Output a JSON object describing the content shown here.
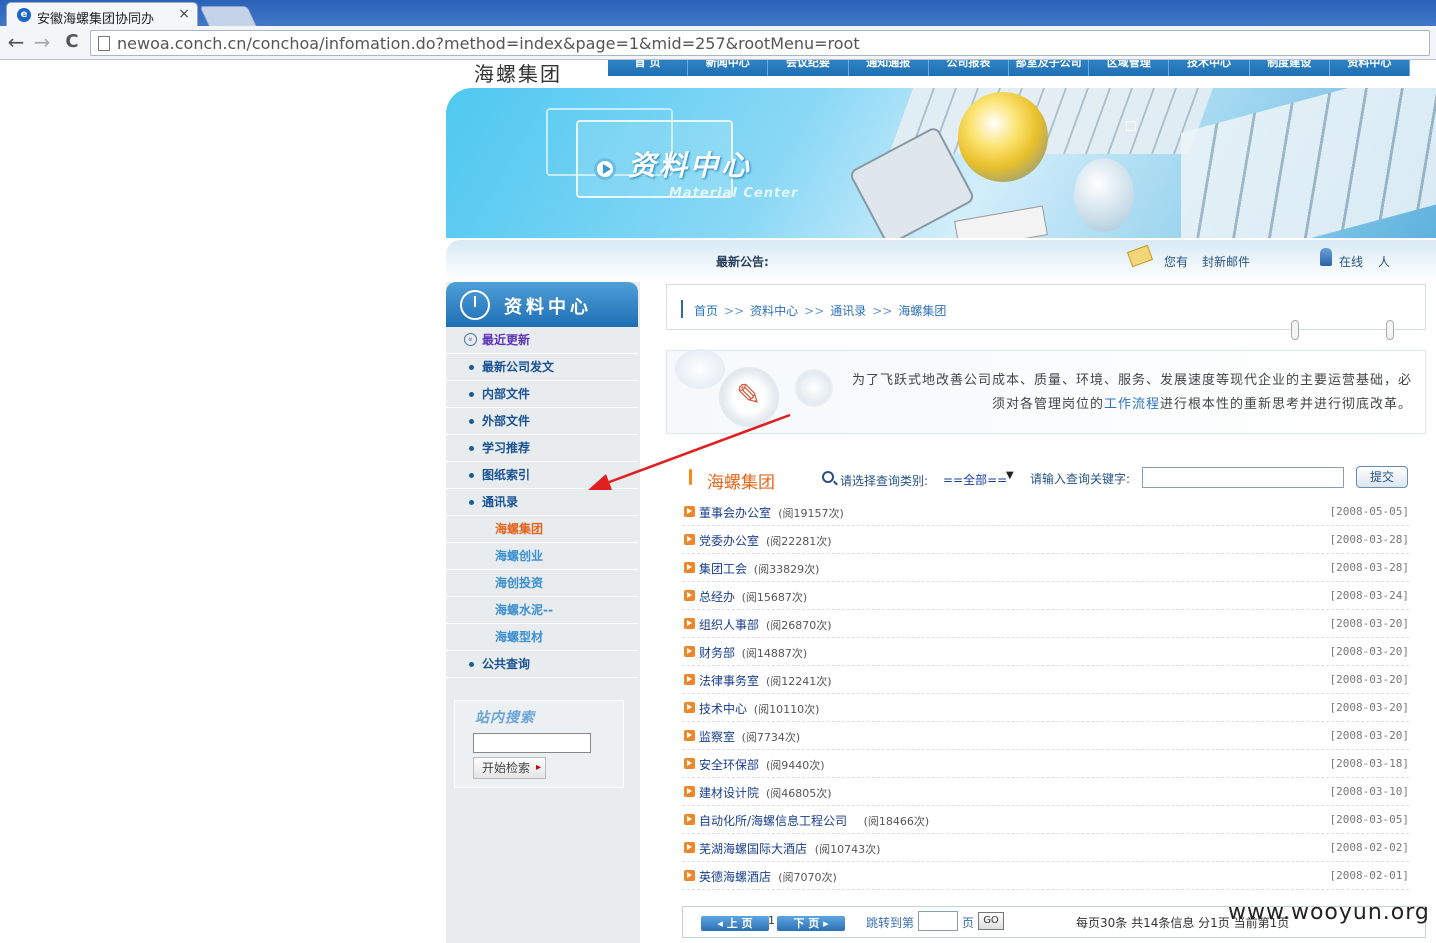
{
  "browser": {
    "tab_title": "安徽海螺集团协同办",
    "tab_close": "×",
    "url": "newoa.conch.cn/conchoa/infomation.do?method=index&page=1&mid=257&rootMenu=root",
    "back": "←",
    "forward": "→",
    "reload": "C"
  },
  "site": {
    "logo": "海螺集团",
    "menu": [
      "首 页",
      "新闻中心",
      "会议纪要",
      "通知通报",
      "公司报表",
      "部室及子公司",
      "区域管理",
      "技术中心",
      "制度建设",
      "资料中心"
    ],
    "banner_title": "资料中心",
    "banner_sub": "Material Center",
    "notice_label": "最新公告:",
    "mail_text1": "您有",
    "mail_text2": "封新邮件",
    "online_text1": "在线",
    "online_text2": "人"
  },
  "sidebar": {
    "title": "资料中心",
    "items": [
      {
        "label": "最近更新",
        "kind": "current"
      },
      {
        "label": "最新公司发文",
        "kind": "item"
      },
      {
        "label": "内部文件",
        "kind": "item"
      },
      {
        "label": "外部文件",
        "kind": "item"
      },
      {
        "label": "学习推荐",
        "kind": "item"
      },
      {
        "label": "图纸索引",
        "kind": "item"
      },
      {
        "label": "通讯录",
        "kind": "item"
      },
      {
        "label": "海螺集团",
        "kind": "sub-active"
      },
      {
        "label": "海螺创业",
        "kind": "sub"
      },
      {
        "label": "海创投资",
        "kind": "sub"
      },
      {
        "label": "海螺水泥--",
        "kind": "sub"
      },
      {
        "label": "海螺型材",
        "kind": "sub"
      },
      {
        "label": "公共查询",
        "kind": "item"
      }
    ],
    "search_title": "站内搜索",
    "search_button": "开始检索"
  },
  "breadcrumb": [
    "首页",
    "资料中心",
    "通讯录",
    "海螺集团"
  ],
  "breadcrumb_sep": ">>",
  "slogan": {
    "part1": "为了飞跃式地改善公司成本、质量、环境、服务、发展速度等现代企业的主要运营基础，必须对各管理岗位的",
    "highlight": "工作流程",
    "part2": "进行根本性的重新思考并进行彻底改革。"
  },
  "list": {
    "title": "海螺集团",
    "category_label": "请选择查询类别:",
    "category_value": "==全部==",
    "keyword_label": "请输入查询关键字:",
    "submit": "提交",
    "rows": [
      {
        "name": "董事会办公室",
        "views": "(阅19157次)",
        "date": "[2008-05-05]"
      },
      {
        "name": "党委办公室",
        "views": "(阅22281次)",
        "date": "[2008-03-28]"
      },
      {
        "name": "集团工会",
        "views": "(阅33829次)",
        "date": "[2008-03-28]"
      },
      {
        "name": "总经办",
        "views": "(阅15687次)",
        "date": "[2008-03-24]"
      },
      {
        "name": "组织人事部",
        "views": "(阅26870次)",
        "date": "[2008-03-20]"
      },
      {
        "name": "财务部",
        "views": "(阅14887次)",
        "date": "[2008-03-20]"
      },
      {
        "name": "法律事务室",
        "views": "(阅12241次)",
        "date": "[2008-03-20]"
      },
      {
        "name": "技术中心",
        "views": "(阅10110次)",
        "date": "[2008-03-20]"
      },
      {
        "name": "监察室",
        "views": "(阅7734次)",
        "date": "[2008-03-20]"
      },
      {
        "name": "安全环保部",
        "views": "(阅9440次)",
        "date": "[2008-03-18]"
      },
      {
        "name": "建材设计院",
        "views": "(阅46805次)",
        "date": "[2008-03-10]"
      },
      {
        "name": "自动化所/海螺信息工程公司",
        "views": "(阅18466次)",
        "date": "[2008-03-05]"
      },
      {
        "name": "芜湖海螺国际大酒店",
        "views": "(阅10743次)",
        "date": "[2008-02-02]"
      },
      {
        "name": "英德海螺酒店",
        "views": "(阅7070次)",
        "date": "[2008-02-01]"
      }
    ]
  },
  "pager": {
    "prev": "上 页",
    "next": "下 页",
    "current": "1",
    "jump_label": "跳转到第",
    "jump_unit": "页",
    "go": "GO",
    "info": "每页30条 共14条信息 分1页 当前第1页"
  },
  "watermark": "www.wooyun.org",
  "colors": {
    "accent_blue": "#1f6fb5",
    "orange": "#e8661a",
    "annotation_red": "#e02020"
  }
}
